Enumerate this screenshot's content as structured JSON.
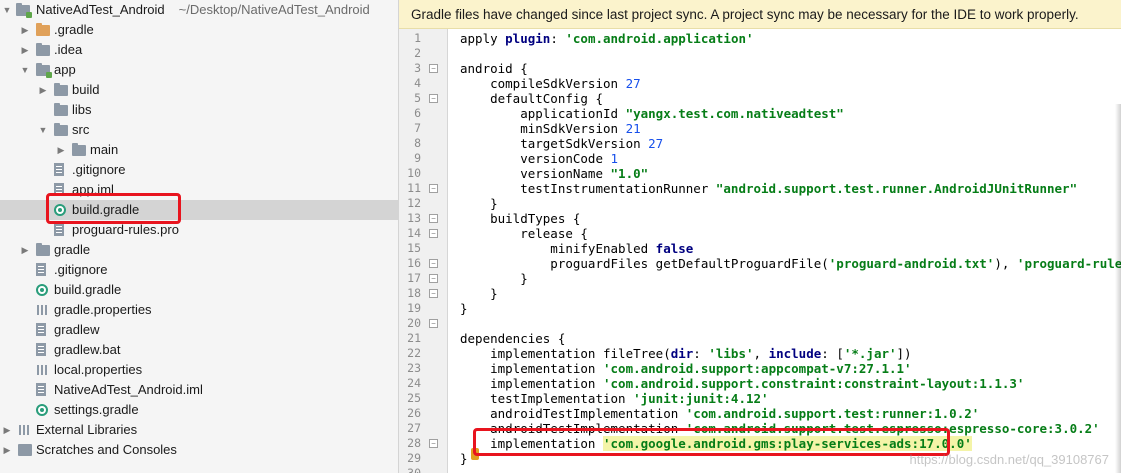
{
  "project": {
    "name": "NativeAdTest_Android",
    "path": "~/Desktop/NativeAdTest_Android",
    "items": [
      {
        "label": ".gradle",
        "depth": 1,
        "icon": "folder-orange",
        "arrow": "right"
      },
      {
        "label": ".idea",
        "depth": 1,
        "icon": "folder",
        "arrow": "right"
      },
      {
        "label": "app",
        "depth": 1,
        "icon": "module-folder",
        "arrow": "down"
      },
      {
        "label": "build",
        "depth": 2,
        "icon": "folder",
        "arrow": "right"
      },
      {
        "label": "libs",
        "depth": 2,
        "icon": "folder",
        "arrow": "none"
      },
      {
        "label": "src",
        "depth": 2,
        "icon": "folder",
        "arrow": "down"
      },
      {
        "label": "main",
        "depth": 3,
        "icon": "folder",
        "arrow": "right"
      },
      {
        "label": ".gitignore",
        "depth": 2,
        "icon": "file",
        "arrow": "none"
      },
      {
        "label": "app.iml",
        "depth": 2,
        "icon": "file",
        "arrow": "none"
      },
      {
        "label": "build.gradle",
        "depth": 2,
        "icon": "gradle",
        "arrow": "none",
        "selected": true
      },
      {
        "label": "proguard-rules.pro",
        "depth": 2,
        "icon": "file",
        "arrow": "none"
      },
      {
        "label": "gradle",
        "depth": 1,
        "icon": "folder",
        "arrow": "right"
      },
      {
        "label": ".gitignore",
        "depth": 1,
        "icon": "file",
        "arrow": "none"
      },
      {
        "label": "build.gradle",
        "depth": 1,
        "icon": "gradle",
        "arrow": "none"
      },
      {
        "label": "gradle.properties",
        "depth": 1,
        "icon": "bars",
        "arrow": "none"
      },
      {
        "label": "gradlew",
        "depth": 1,
        "icon": "file",
        "arrow": "none"
      },
      {
        "label": "gradlew.bat",
        "depth": 1,
        "icon": "file",
        "arrow": "none"
      },
      {
        "label": "local.properties",
        "depth": 1,
        "icon": "bars",
        "arrow": "none"
      },
      {
        "label": "NativeAdTest_Android.iml",
        "depth": 1,
        "icon": "file",
        "arrow": "none"
      },
      {
        "label": "settings.gradle",
        "depth": 1,
        "icon": "gradle",
        "arrow": "none"
      },
      {
        "label": "External Libraries",
        "depth": 0,
        "icon": "bars",
        "arrow": "right"
      },
      {
        "label": "Scratches and Consoles",
        "depth": 0,
        "icon": "scratch",
        "arrow": "right"
      }
    ]
  },
  "banner": "Gradle files have changed since last project sync. A project sync may be necessary for the IDE to work properly.",
  "code_lines": [
    [
      [
        "t",
        "apply "
      ],
      [
        "kw",
        "plugin"
      ],
      [
        "t",
        ": "
      ],
      [
        "str",
        "'com.android.application'"
      ]
    ],
    [],
    [
      [
        "t",
        "android {"
      ]
    ],
    [
      [
        "t",
        "    compileSdkVersion "
      ],
      [
        "num",
        "27"
      ]
    ],
    [
      [
        "t",
        "    defaultConfig {"
      ]
    ],
    [
      [
        "t",
        "        applicationId "
      ],
      [
        "str",
        "\"yangx.test.com.nativeadtest\""
      ]
    ],
    [
      [
        "t",
        "        minSdkVersion "
      ],
      [
        "num",
        "21"
      ]
    ],
    [
      [
        "t",
        "        targetSdkVersion "
      ],
      [
        "num",
        "27"
      ]
    ],
    [
      [
        "t",
        "        versionCode "
      ],
      [
        "num",
        "1"
      ]
    ],
    [
      [
        "t",
        "        versionName "
      ],
      [
        "str",
        "\"1.0\""
      ]
    ],
    [
      [
        "t",
        "        testInstrumentationRunner "
      ],
      [
        "str",
        "\"android.support.test.runner.AndroidJUnitRunner\""
      ]
    ],
    [
      [
        "t",
        "    }"
      ]
    ],
    [
      [
        "t",
        "    buildTypes {"
      ]
    ],
    [
      [
        "t",
        "        release {"
      ]
    ],
    [
      [
        "t",
        "            minifyEnabled "
      ],
      [
        "kw",
        "false"
      ]
    ],
    [
      [
        "t",
        "            proguardFiles getDefaultProguardFile("
      ],
      [
        "str",
        "'proguard-android.txt'"
      ],
      [
        "t",
        "), "
      ],
      [
        "str",
        "'proguard-rules.pro'"
      ]
    ],
    [
      [
        "t",
        "        }"
      ]
    ],
    [
      [
        "t",
        "    }"
      ]
    ],
    [
      [
        "t",
        "}"
      ]
    ],
    [],
    [
      [
        "t",
        "dependencies {"
      ]
    ],
    [
      [
        "t",
        "    implementation fileTree("
      ],
      [
        "kw",
        "dir"
      ],
      [
        "t",
        ": "
      ],
      [
        "str",
        "'libs'"
      ],
      [
        "t",
        ", "
      ],
      [
        "kw",
        "include"
      ],
      [
        "t",
        ": ["
      ],
      [
        "str",
        "'*.jar'"
      ],
      [
        "t",
        "])"
      ]
    ],
    [
      [
        "t",
        "    implementation "
      ],
      [
        "str",
        "'com.android.support:appcompat-v7:27.1.1'"
      ]
    ],
    [
      [
        "t",
        "    implementation "
      ],
      [
        "str",
        "'com.android.support.constraint:constraint-layout:1.1.3'"
      ]
    ],
    [
      [
        "t",
        "    testImplementation "
      ],
      [
        "str",
        "'junit:junit:4.12'"
      ]
    ],
    [
      [
        "t",
        "    androidTestImplementation "
      ],
      [
        "str",
        "'com.android.support.test:runner:1.0.2'"
      ]
    ],
    [
      [
        "t",
        "    androidTestImplementation "
      ],
      [
        "str",
        "'com.android.support.test.espresso:espresso-core:3.0.2'"
      ]
    ],
    [
      [
        "t",
        "    implementation "
      ],
      [
        "hl",
        "'com.google.android.gms:play-services-ads:17.0.0'"
      ]
    ],
    [
      [
        "t",
        "}"
      ]
    ],
    []
  ],
  "watermark": "https://blog.csdn.net/qq_39108767"
}
